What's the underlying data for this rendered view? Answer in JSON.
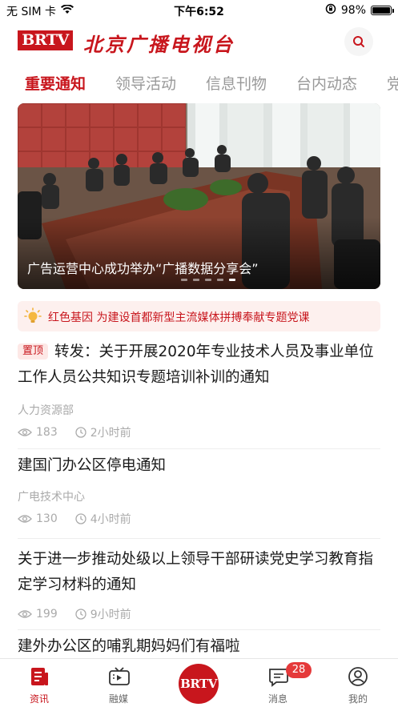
{
  "status_bar": {
    "carrier": "无 SIM 卡",
    "time": "下午6:52",
    "battery": "98%",
    "battery_level": 0.98
  },
  "header": {
    "logo_text": "BRTV",
    "brand_name": "北京广播电视台",
    "search_icon": "search-icon"
  },
  "tabs": [
    {
      "label": "重要通知",
      "active": true
    },
    {
      "label": "领导活动"
    },
    {
      "label": "信息刊物"
    },
    {
      "label": "台内动态"
    },
    {
      "label": "党"
    }
  ],
  "banner": {
    "caption": "广告运营中心成功举办“广播数据分享会”",
    "page_count": 5,
    "current_page": 5
  },
  "notice": {
    "icon": "lightbulb-icon",
    "text": "红色基因 为建设首都新型主流媒体拼搏奉献专题党课"
  },
  "news": [
    {
      "pinned_label": "置顶",
      "title": "转发：关于开展2020年专业技术人员及事业单位工作人员公共知识专题培训补训的通知",
      "source": "人力资源部",
      "views": "183",
      "time": "2小时前"
    },
    {
      "title": "建国门办公区停电通知",
      "source": "广电技术中心",
      "views": "130",
      "time": "4小时前"
    },
    {
      "title": "关于进一步推动处级以上领导干部研读党史学习教育指定学习材料的通知",
      "views": "199",
      "time": "9小时前"
    },
    {
      "title": "建外办公区的哺乳期妈妈们有福啦"
    }
  ],
  "bottom_nav": {
    "items": [
      {
        "label": "资讯",
        "icon": "news-icon",
        "active": true
      },
      {
        "label": "融媒",
        "icon": "media-icon"
      },
      {
        "label": "BRTV",
        "icon": "brtv-logo"
      },
      {
        "label": "消息",
        "icon": "message-icon",
        "badge": "28"
      },
      {
        "label": "我的",
        "icon": "profile-icon"
      }
    ]
  },
  "colors": {
    "brand_red": "#c8161d",
    "tab_inactive": "#999999",
    "meta_gray": "#aaaaaa"
  }
}
